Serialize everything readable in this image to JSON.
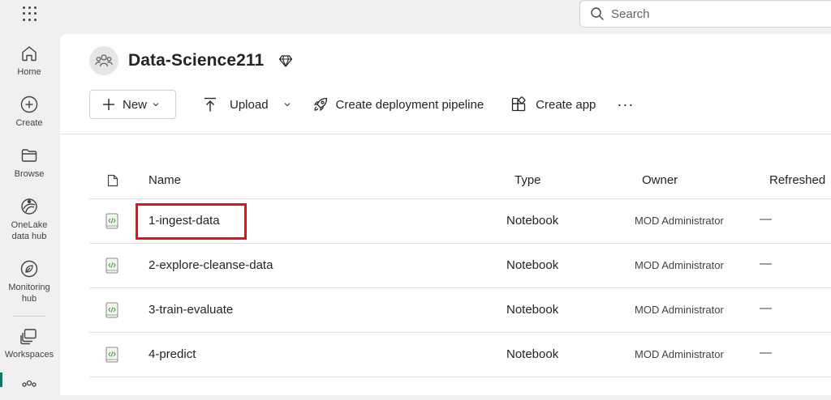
{
  "search": {
    "placeholder": "Search"
  },
  "nav": {
    "home": "Home",
    "create": "Create",
    "browse": "Browse",
    "onelake_line1": "OneLake",
    "onelake_line2": "data hub",
    "monitoring_line1": "Monitoring",
    "monitoring_line2": "hub",
    "workspaces": "Workspaces"
  },
  "workspace": {
    "title": "Data-Science211"
  },
  "toolbar": {
    "new_label": "New",
    "upload_label": "Upload",
    "deploy_label": "Create deployment pipeline",
    "app_label": "Create app",
    "more_label": "···"
  },
  "table": {
    "headers": {
      "name": "Name",
      "type": "Type",
      "owner": "Owner",
      "refreshed": "Refreshed"
    },
    "rows": [
      {
        "name": "1-ingest-data",
        "type": "Notebook",
        "owner": "MOD Administrator",
        "refreshed": "—"
      },
      {
        "name": "2-explore-cleanse-data",
        "type": "Notebook",
        "owner": "MOD Administrator",
        "refreshed": "—"
      },
      {
        "name": "3-train-evaluate",
        "type": "Notebook",
        "owner": "MOD Administrator",
        "refreshed": "—"
      },
      {
        "name": "4-predict",
        "type": "Notebook",
        "owner": "MOD Administrator",
        "refreshed": "—"
      }
    ]
  },
  "highlight": {
    "row_index": 0,
    "color": "#e3101d"
  },
  "colors": {
    "accent": "#117865"
  }
}
